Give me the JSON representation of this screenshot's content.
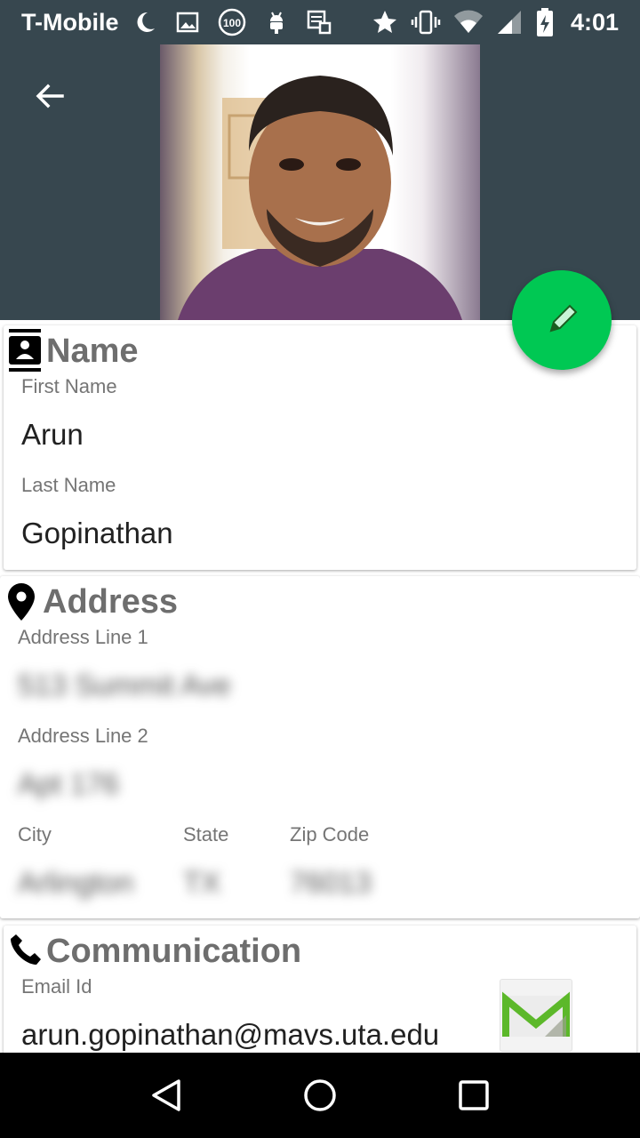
{
  "status_bar": {
    "carrier": "T-Mobile",
    "time": "4:01",
    "icons_left": [
      "moon-icon",
      "image-icon",
      "100-badge-icon",
      "android-icon",
      "tasks-icon"
    ],
    "icons_right": [
      "star-icon",
      "vibrate-icon",
      "wifi-icon",
      "signal-icon",
      "battery-charging-icon"
    ],
    "badge_text": "100"
  },
  "header": {
    "back_icon": "arrow-back-icon",
    "background_color": "#37474f"
  },
  "fab": {
    "icon": "pencil-icon",
    "color": "#00c853"
  },
  "name_section": {
    "title": "Name",
    "icon": "contact-card-icon",
    "first_name_label": "First Name",
    "first_name_value": "Arun",
    "last_name_label": "Last Name",
    "last_name_value": "Gopinathan"
  },
  "address_section": {
    "title": "Address",
    "icon": "location-pin-icon",
    "line1_label": "Address Line 1",
    "line1_value": "513 Summit Ave",
    "line2_label": "Address Line 2",
    "line2_value": "Apt 176",
    "city_label": "City",
    "city_value": "Arlington",
    "state_label": "State",
    "state_value": "TX",
    "zip_label": "Zip Code",
    "zip_value": "76013"
  },
  "communication_section": {
    "title": "Communication",
    "icon": "phone-icon",
    "email_label": "Email Id",
    "email_value": "arun.gopinathan@mavs.uta.edu",
    "email_app_icon": "gmail-icon"
  },
  "nav_bar": {
    "buttons": [
      "back-triangle-icon",
      "home-circle-icon",
      "recents-square-icon"
    ]
  }
}
